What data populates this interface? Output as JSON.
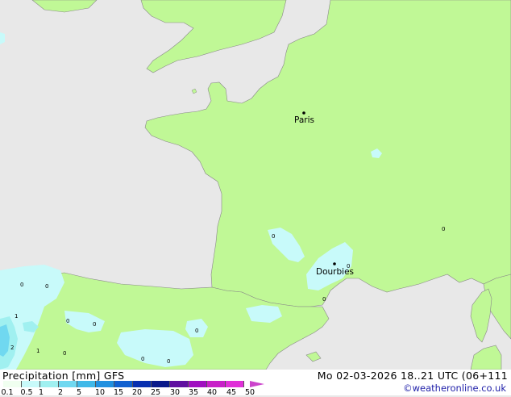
{
  "map": {
    "cities": [
      {
        "name": "Paris"
      },
      {
        "name": "Dourbies"
      }
    ],
    "point_values": [
      "0",
      "0",
      "0",
      "0",
      "0",
      "0",
      "0",
      "0",
      "0",
      "0",
      "0",
      "0",
      "1",
      "1",
      "2"
    ]
  },
  "legend": {
    "title": "Precipitation [mm]  GFS",
    "datetime": "Mo 02-03-2026 18..21 UTC (06+111",
    "credit": "©weatheronline.co.uk",
    "ticks": [
      "0.1",
      "0.5",
      "1",
      "2",
      "5",
      "10",
      "15",
      "20",
      "25",
      "30",
      "35",
      "40",
      "45",
      "50"
    ],
    "colors": [
      "#f0fff0",
      "#c8fafa",
      "#a0f0f0",
      "#70d8f0",
      "#40b8e8",
      "#2090e0",
      "#1060d0",
      "#0830b0",
      "#0a1a8a",
      "#6010a0",
      "#a010c0",
      "#c820c8",
      "#e030d8"
    ]
  }
}
